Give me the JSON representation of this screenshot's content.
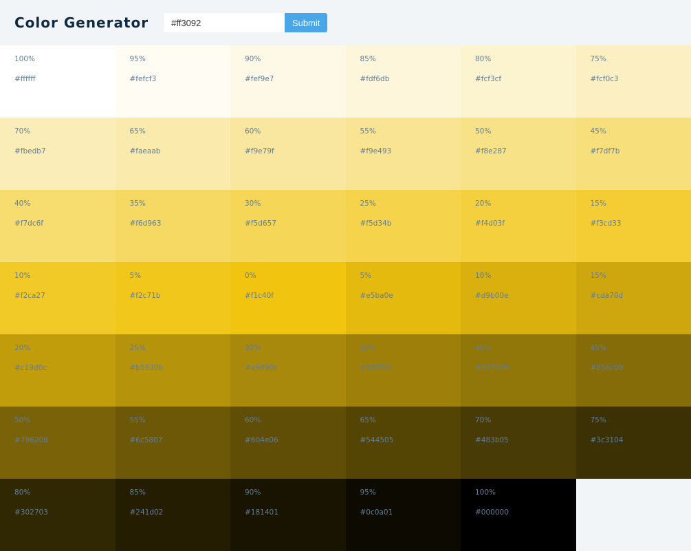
{
  "header": {
    "title": "Color Generator",
    "hex_input_value": "#ff3092",
    "submit_label": "Submit"
  },
  "swatches": [
    {
      "percent": "100%",
      "hex": "#ffffff"
    },
    {
      "percent": "95%",
      "hex": "#fefcf3"
    },
    {
      "percent": "90%",
      "hex": "#fef9e7"
    },
    {
      "percent": "85%",
      "hex": "#fdf6db"
    },
    {
      "percent": "80%",
      "hex": "#fcf3cf"
    },
    {
      "percent": "75%",
      "hex": "#fcf0c3"
    },
    {
      "percent": "70%",
      "hex": "#fbedb7"
    },
    {
      "percent": "65%",
      "hex": "#faeaab"
    },
    {
      "percent": "60%",
      "hex": "#f9e79f"
    },
    {
      "percent": "55%",
      "hex": "#f9e493"
    },
    {
      "percent": "50%",
      "hex": "#f8e287"
    },
    {
      "percent": "45%",
      "hex": "#f7df7b"
    },
    {
      "percent": "40%",
      "hex": "#f7dc6f"
    },
    {
      "percent": "35%",
      "hex": "#f6d963"
    },
    {
      "percent": "30%",
      "hex": "#f5d657"
    },
    {
      "percent": "25%",
      "hex": "#f5d34b"
    },
    {
      "percent": "20%",
      "hex": "#f4d03f"
    },
    {
      "percent": "15%",
      "hex": "#f3cd33"
    },
    {
      "percent": "10%",
      "hex": "#f2ca27"
    },
    {
      "percent": "5%",
      "hex": "#f2c71b"
    },
    {
      "percent": "0%",
      "hex": "#f1c40f"
    },
    {
      "percent": "5%",
      "hex": "#e5ba0e"
    },
    {
      "percent": "10%",
      "hex": "#d9b00e"
    },
    {
      "percent": "15%",
      "hex": "#cda70d"
    },
    {
      "percent": "20%",
      "hex": "#c19d0c"
    },
    {
      "percent": "25%",
      "hex": "#b5930b"
    },
    {
      "percent": "30%",
      "hex": "#a9890b"
    },
    {
      "percent": "35%",
      "hex": "#9d7f0a"
    },
    {
      "percent": "40%",
      "hex": "#917609"
    },
    {
      "percent": "45%",
      "hex": "#856c08"
    },
    {
      "percent": "50%",
      "hex": "#796208"
    },
    {
      "percent": "55%",
      "hex": "#6c5807"
    },
    {
      "percent": "60%",
      "hex": "#604e06"
    },
    {
      "percent": "65%",
      "hex": "#544505"
    },
    {
      "percent": "70%",
      "hex": "#483b05"
    },
    {
      "percent": "75%",
      "hex": "#3c3104"
    },
    {
      "percent": "80%",
      "hex": "#302703"
    },
    {
      "percent": "85%",
      "hex": "#241d02"
    },
    {
      "percent": "90%",
      "hex": "#181401"
    },
    {
      "percent": "95%",
      "hex": "#0c0a01"
    },
    {
      "percent": "100%",
      "hex": "#000000"
    }
  ]
}
